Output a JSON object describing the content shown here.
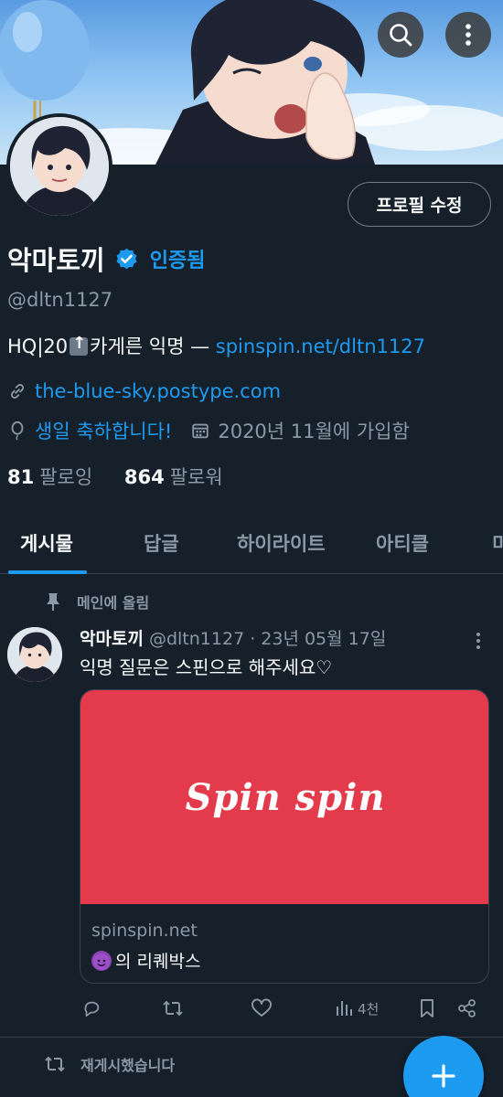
{
  "header": {
    "search_icon": "search-icon",
    "more_icon": "more-vertical-icon"
  },
  "profile": {
    "edit_button": "프로필 수정",
    "name": "악마토끼",
    "verified_label": "인증됨",
    "handle": "@dltn1127",
    "bio_prefix": "HQ|20",
    "bio_middle": "카게른  익명 — ",
    "bio_link": "spinspin.net/dltn1127",
    "website": "the-blue-sky.postype.com",
    "birthday": "생일 축하합니다!",
    "joined": "2020년 11월에 가입함",
    "following_count": "81",
    "following_label": "팔로잉",
    "followers_count": "864",
    "followers_label": "팔로워"
  },
  "tabs": [
    {
      "label": "게시물"
    },
    {
      "label": "답글"
    },
    {
      "label": "하이라이트"
    },
    {
      "label": "아티클"
    },
    {
      "label": "미"
    }
  ],
  "pinned": {
    "label": "메인에 올림",
    "author": "악마토끼",
    "meta": "@dltn1127 · 23년 05월 17일",
    "text": "익명 질문은 스핀으로 해주세요♡",
    "card": {
      "logo": "Spin spin",
      "domain": "spinspin.net",
      "title": "의 리퀘박스"
    },
    "views": "4천"
  },
  "repost": {
    "label": "재게시했습니다"
  },
  "colors": {
    "background": "#15202b",
    "accent": "#1d9bf0",
    "muted": "#8b98a5",
    "card_red": "#e33b4b"
  }
}
